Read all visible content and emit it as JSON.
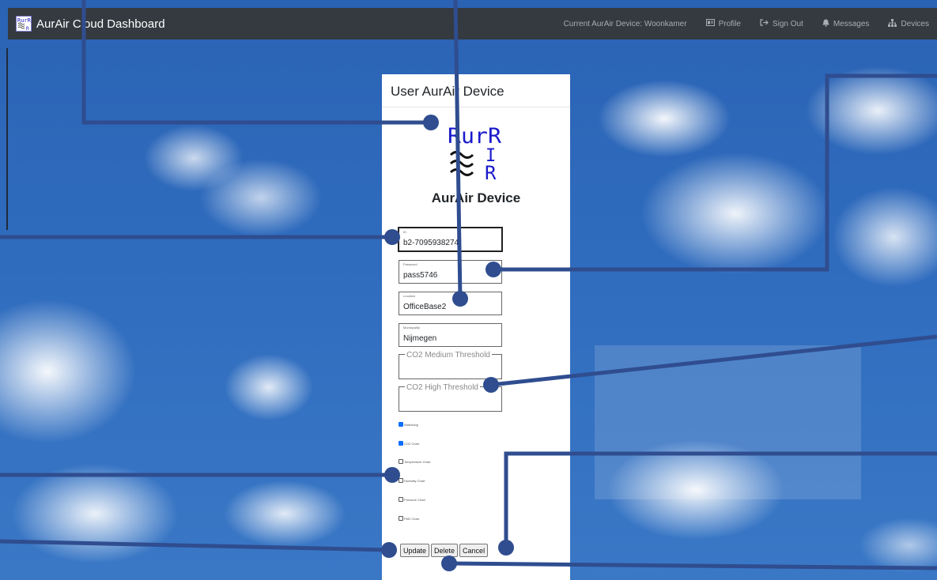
{
  "colors": {
    "navbar_bg": "#343a40",
    "annotation_line": "#2f4d8f",
    "checkbox_checked": "#0d6efd",
    "logo_blue": "#1a1acc"
  },
  "navbar": {
    "brand_logo_icon": "aurair-logo-icon",
    "brand_title": "AurAir Cloud Dashboard",
    "current_device": "Current AurAir Device: Woonkamer",
    "items": [
      {
        "icon": "id-card-icon",
        "label": "Profile"
      },
      {
        "icon": "sign-out-icon",
        "label": "Sign Out"
      },
      {
        "icon": "bell-icon",
        "label": "Messages"
      },
      {
        "icon": "sitemap-icon",
        "label": "Devices"
      }
    ]
  },
  "card": {
    "header": "User AurAir Device",
    "title": "AurAir Device",
    "fields": {
      "id": {
        "label": "ID",
        "value": "b2-7095938274"
      },
      "password": {
        "label": "Password",
        "value": "pass5746"
      },
      "location": {
        "label": "Location",
        "value": "OfficeBase2"
      },
      "municipality": {
        "label": "Municipality",
        "value": "Nijmegen"
      }
    },
    "textareas": {
      "co2_medium": {
        "placeholder": "CO2 Medium Threshold"
      },
      "co2_high": {
        "placeholder": "CO2 High Threshold"
      }
    },
    "checkboxes": [
      {
        "label": "Watchdog",
        "checked": true
      },
      {
        "label": "CO2 Chart",
        "checked": true
      },
      {
        "label": "Temperature Chart",
        "checked": false
      },
      {
        "label": "Humidity Chart",
        "checked": false
      },
      {
        "label": "Pressure Chart",
        "checked": false
      },
      {
        "label": "PM2 Chart",
        "checked": false
      }
    ],
    "buttons": {
      "update": "Update",
      "delete": "Delete",
      "cancel": "Cancel"
    }
  }
}
